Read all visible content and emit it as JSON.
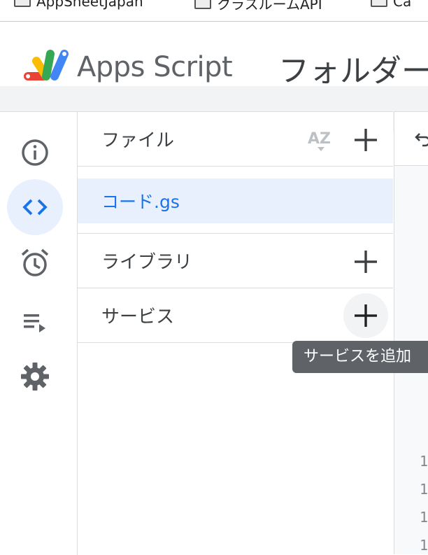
{
  "bookmarks": [
    {
      "label": "AppSheetJapan",
      "icon": "folder-icon"
    },
    {
      "label": "クラスルームAPI",
      "icon": "folder-icon"
    },
    {
      "label": "Ca",
      "icon": "folder-icon"
    }
  ],
  "header": {
    "app_title": "Apps Script",
    "project_title": "フォルダー",
    "logo": "apps-script-logo"
  },
  "rail": {
    "items": [
      {
        "name": "overview",
        "icon": "info-icon",
        "active": false
      },
      {
        "name": "editor",
        "icon": "code-icon",
        "active": true
      },
      {
        "name": "triggers",
        "icon": "alarm-icon",
        "active": false
      },
      {
        "name": "executions",
        "icon": "playlist-icon",
        "active": false
      },
      {
        "name": "settings",
        "icon": "gear-icon",
        "active": false
      }
    ]
  },
  "panel": {
    "files_label": "ファイル",
    "sort_icon": "sort-az-icon",
    "files": [
      {
        "name": "コード.gs",
        "selected": true
      }
    ],
    "libraries_label": "ライブラリ",
    "services_label": "サービス"
  },
  "tooltip": {
    "text": "サービスを追加"
  },
  "editor": {
    "line_numbers": [
      "1",
      "1",
      "1",
      "1"
    ]
  },
  "colors": {
    "accent": "#1a73e8",
    "active_bg": "#e8f0fe",
    "tooltip_bg": "#5f6368"
  }
}
